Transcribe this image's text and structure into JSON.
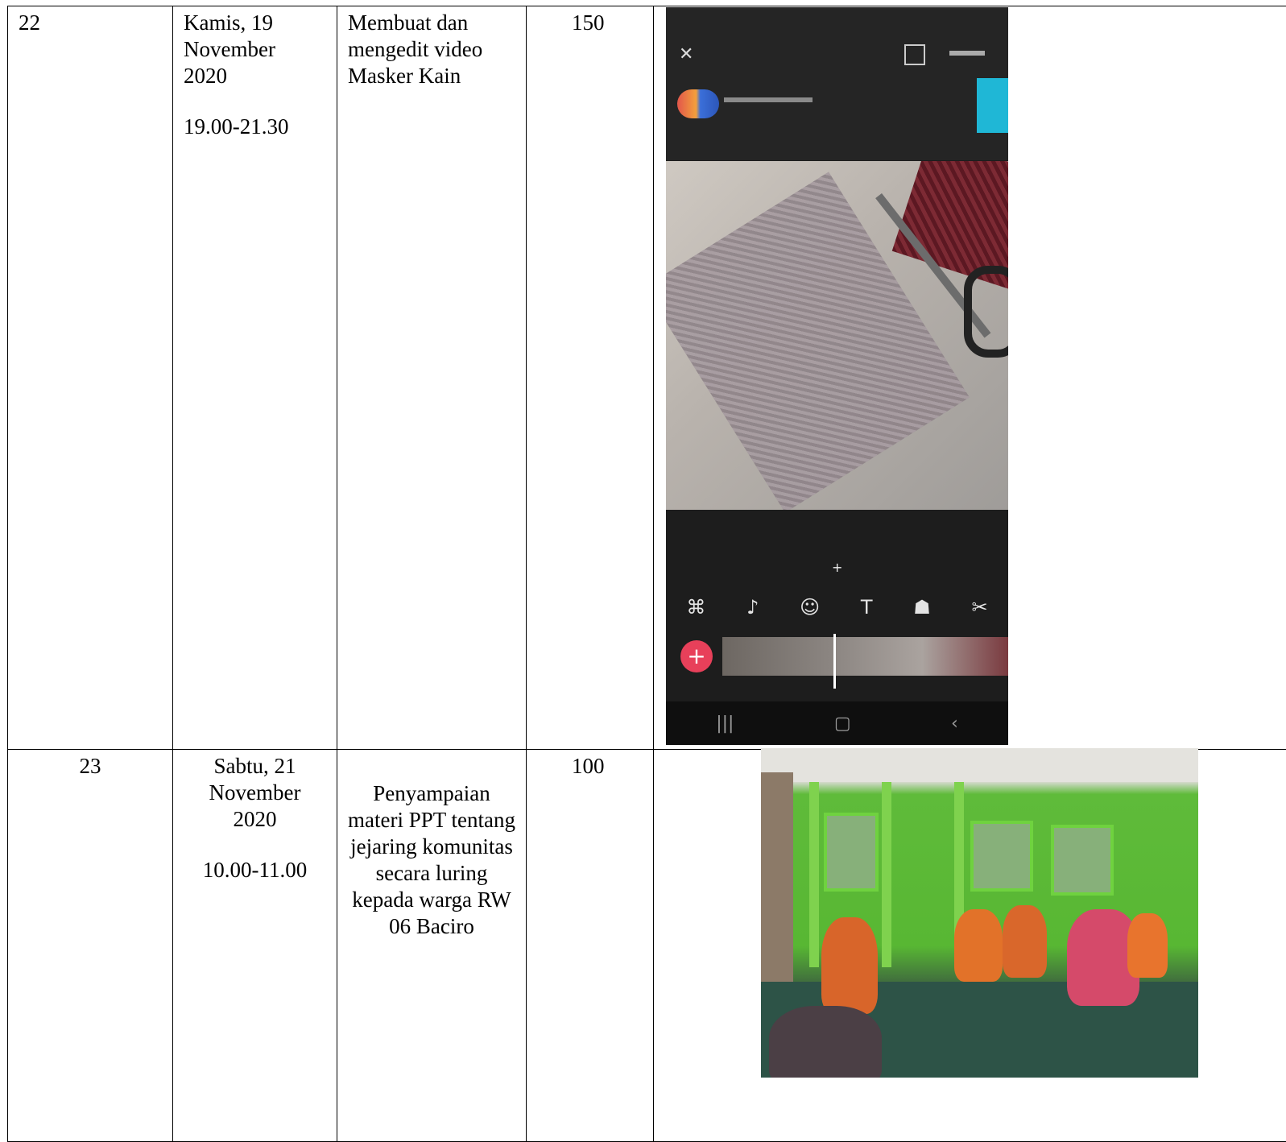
{
  "rows": [
    {
      "no": "22",
      "date_line1": "Kamis, 19",
      "date_line2": "November",
      "date_line3": "2020",
      "time": "19.00-21.30",
      "activity": "Membuat dan mengedit video Masker Kain",
      "duration": "150",
      "documentation": "phone-screenshot-video-editor"
    },
    {
      "no": "23",
      "date_line1": "Sabtu, 21",
      "date_line2": "November",
      "date_line3": "2020",
      "time": "10.00-11.00",
      "activity": "Penyampaian materi PPT tentang jejaring komunitas secara luring kepada warga RW 06 Baciro",
      "duration": "100",
      "documentation": "photo-community-meeting"
    }
  ],
  "colors": {
    "border": "#000000",
    "phone_background": "#1d1d1d",
    "accent_cyan": "#1fb7d6",
    "add_button": "#e8405a",
    "wall_green": "#58b733"
  }
}
